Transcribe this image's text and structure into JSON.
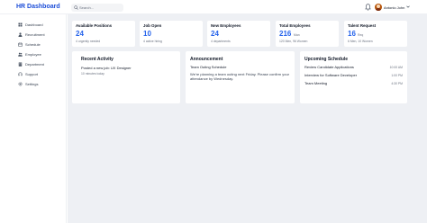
{
  "header": {
    "brand": "HR Dashboard",
    "search_placeholder": "Search...",
    "user_name": "Antonio John"
  },
  "sidebar": {
    "items": [
      {
        "label": "Dashboard",
        "icon": "grid-icon"
      },
      {
        "label": "Recruitment",
        "icon": "user-icon"
      },
      {
        "label": "Schedule",
        "icon": "calendar-icon"
      },
      {
        "label": "Employee",
        "icon": "users-icon"
      },
      {
        "label": "Department",
        "icon": "building-icon"
      },
      {
        "label": "Support",
        "icon": "headset-icon"
      },
      {
        "label": "Settings",
        "icon": "gear-icon"
      }
    ]
  },
  "stats": [
    {
      "title": "Available Positions",
      "value": "24",
      "unit": "",
      "sub": "4 urgently needed"
    },
    {
      "title": "Job Open",
      "value": "10",
      "unit": "",
      "sub": "4 active hiring"
    },
    {
      "title": "New Employees",
      "value": "24",
      "unit": "",
      "sub": "4 departments"
    },
    {
      "title": "Total Employees",
      "value": "216",
      "unit": "Man",
      "sub": "120 Men, 96 Women"
    },
    {
      "title": "Talent Request",
      "value": "16",
      "unit": "Req",
      "sub": "6 Men, 10 Women"
    }
  ],
  "recent_activity": {
    "title": "Recent Activity",
    "item_title": "Posted a new job: UX Designer",
    "item_time": "10 minutes today"
  },
  "announcement": {
    "title": "Announcement",
    "item_title": "Team Outing Schedule",
    "item_body": "We're planning a team outing next Friday. Please confirm your attendance by Wednesday."
  },
  "upcoming_schedule": {
    "title": "Upcoming Schedule",
    "items": [
      {
        "name": "Review Candidate Applications",
        "time": "10:00 AM"
      },
      {
        "name": "Interview for Software Developer",
        "time": "1:00 PM"
      },
      {
        "name": "Team Meeting",
        "time": "4:30 PM"
      }
    ]
  },
  "colors": {
    "brand": "#1d4ed8",
    "accent": "#2563eb",
    "background": "#eef0f4"
  }
}
